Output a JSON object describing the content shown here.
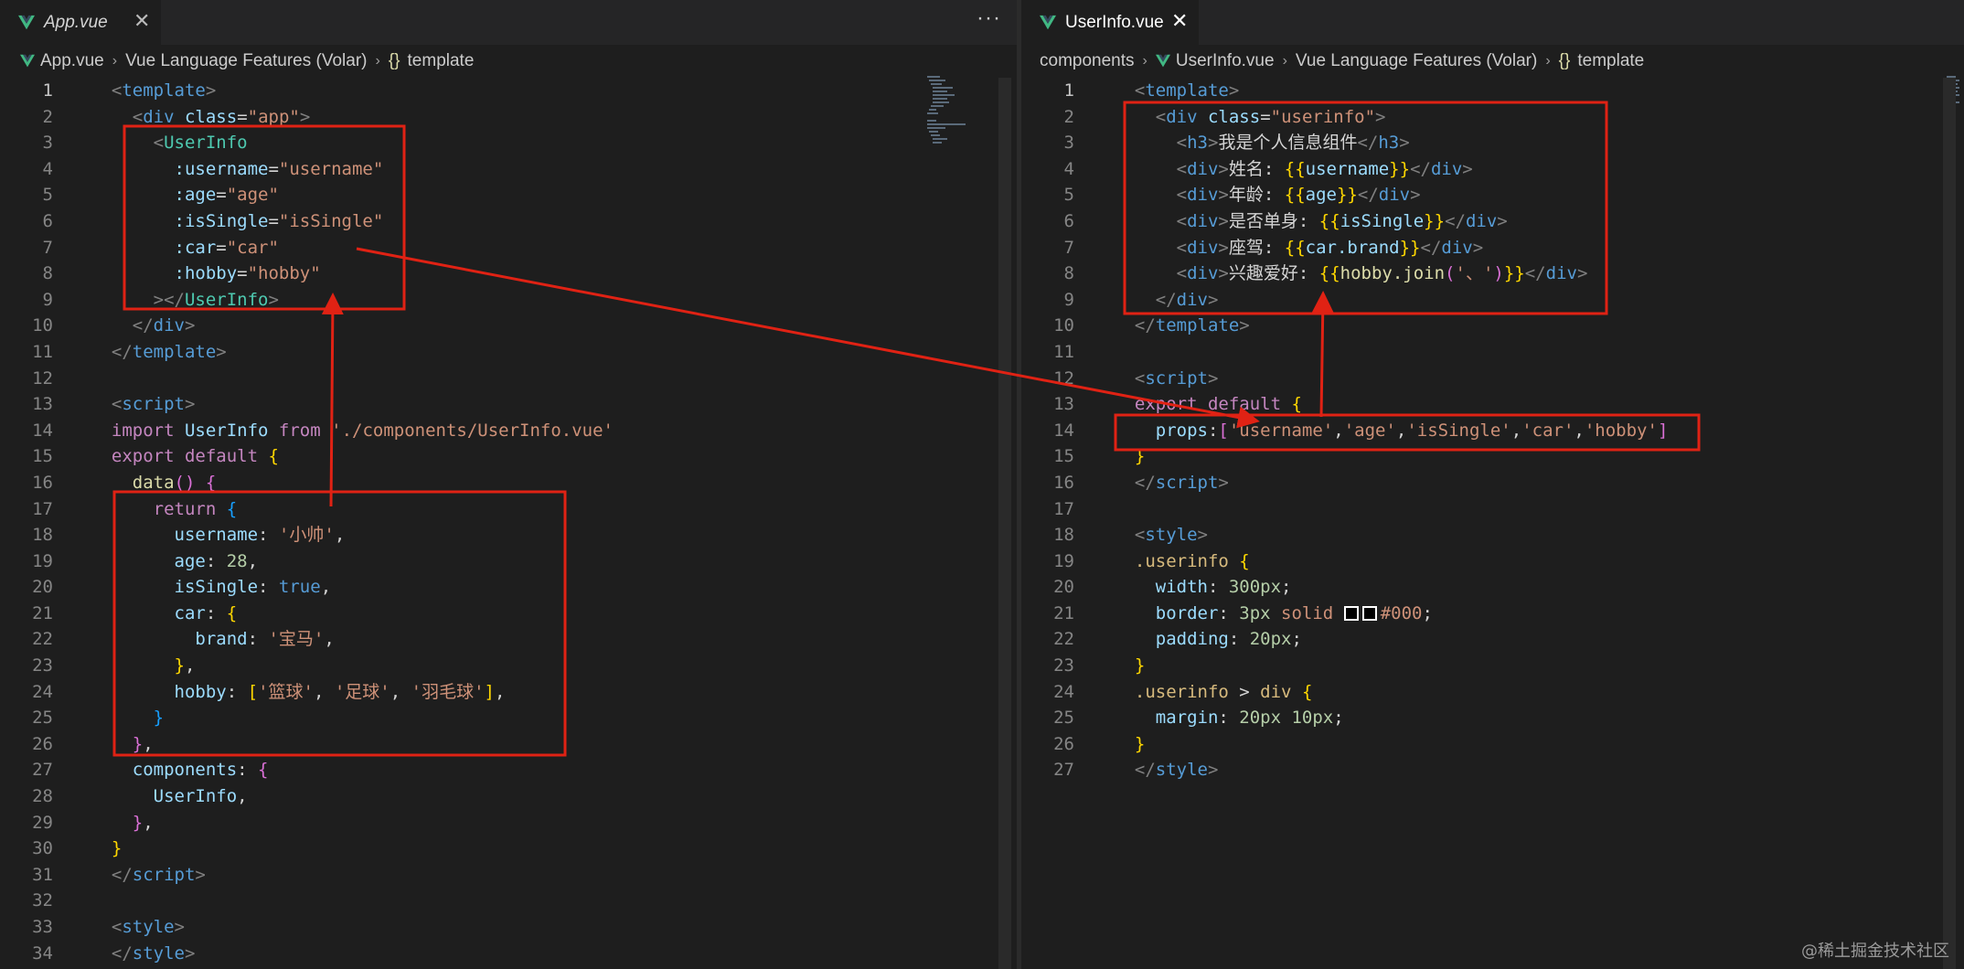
{
  "left": {
    "tab": {
      "title": "App.vue",
      "close": "✕"
    },
    "more": "···",
    "breadcrumb": [
      "App.vue",
      "Vue Language Features (Volar)",
      "template"
    ],
    "active_line": 1,
    "lines": [
      [
        [
          "  ",
          "t"
        ],
        [
          "<",
          "g"
        ],
        [
          "template",
          "b"
        ],
        [
          ">",
          "g"
        ]
      ],
      [
        [
          "    ",
          "t"
        ],
        [
          "<",
          "g"
        ],
        [
          "div",
          "b"
        ],
        [
          " class",
          "l"
        ],
        [
          "=",
          "t"
        ],
        [
          "\"app\"",
          "o"
        ],
        [
          ">",
          "g"
        ]
      ],
      [
        [
          "      ",
          "t"
        ],
        [
          "<",
          "g"
        ],
        [
          "UserInfo",
          "c"
        ]
      ],
      [
        [
          "        :username",
          "l"
        ],
        [
          "=",
          "t"
        ],
        [
          "\"username\"",
          "o"
        ]
      ],
      [
        [
          "        :age",
          "l"
        ],
        [
          "=",
          "t"
        ],
        [
          "\"age\"",
          "o"
        ]
      ],
      [
        [
          "        :isSingle",
          "l"
        ],
        [
          "=",
          "t"
        ],
        [
          "\"isSingle\"",
          "o"
        ]
      ],
      [
        [
          "        :car",
          "l"
        ],
        [
          "=",
          "t"
        ],
        [
          "\"car\"",
          "o"
        ]
      ],
      [
        [
          "        :hobby",
          "l"
        ],
        [
          "=",
          "t"
        ],
        [
          "\"hobby\"",
          "o"
        ]
      ],
      [
        [
          "      ",
          "t"
        ],
        [
          "></",
          "g"
        ],
        [
          "UserInfo",
          "c"
        ],
        [
          ">",
          "g"
        ]
      ],
      [
        [
          "    ",
          "t"
        ],
        [
          "</",
          "g"
        ],
        [
          "div",
          "b"
        ],
        [
          ">",
          "g"
        ]
      ],
      [
        [
          "  ",
          "t"
        ],
        [
          "</",
          "g"
        ],
        [
          "template",
          "b"
        ],
        [
          ">",
          "g"
        ]
      ],
      [],
      [
        [
          "  ",
          "t"
        ],
        [
          "<",
          "g"
        ],
        [
          "script",
          "b"
        ],
        [
          ">",
          "g"
        ]
      ],
      [
        [
          "  import",
          "p"
        ],
        [
          " UserInfo ",
          "l"
        ],
        [
          "from",
          "p"
        ],
        [
          " '",
          "o"
        ],
        [
          "./components/UserInfo.vue",
          "o"
        ],
        [
          "'",
          "o"
        ]
      ],
      [
        [
          "  export",
          "p"
        ],
        [
          " default",
          "p"
        ],
        [
          " {",
          "y"
        ]
      ],
      [
        [
          "    data",
          "f"
        ],
        [
          "()",
          "p2"
        ],
        [
          " {",
          "p2"
        ]
      ],
      [
        [
          "      return",
          "p"
        ],
        [
          " {",
          "b2"
        ]
      ],
      [
        [
          "        username",
          "l"
        ],
        [
          ": ",
          "t"
        ],
        [
          "'小帅'",
          "o"
        ],
        [
          ",",
          "t"
        ]
      ],
      [
        [
          "        age",
          "l"
        ],
        [
          ": ",
          "t"
        ],
        [
          "28",
          "n"
        ],
        [
          ",",
          "t"
        ]
      ],
      [
        [
          "        isSingle",
          "l"
        ],
        [
          ": ",
          "t"
        ],
        [
          "true",
          "b"
        ],
        [
          ",",
          "t"
        ]
      ],
      [
        [
          "        car",
          "l"
        ],
        [
          ": ",
          "t"
        ],
        [
          "{",
          "y"
        ]
      ],
      [
        [
          "          brand",
          "l"
        ],
        [
          ": ",
          "t"
        ],
        [
          "'宝马'",
          "o"
        ],
        [
          ",",
          "t"
        ]
      ],
      [
        [
          "        ",
          "t"
        ],
        [
          "}",
          "y"
        ],
        [
          ",",
          "t"
        ]
      ],
      [
        [
          "        hobby",
          "l"
        ],
        [
          ": ",
          "t"
        ],
        [
          "[",
          "y"
        ],
        [
          "'篮球'",
          "o"
        ],
        [
          ", ",
          "t"
        ],
        [
          "'足球'",
          "o"
        ],
        [
          ", ",
          "t"
        ],
        [
          "'羽毛球'",
          "o"
        ],
        [
          "]",
          "y"
        ],
        [
          ",",
          "t"
        ]
      ],
      [
        [
          "      ",
          "t"
        ],
        [
          "}",
          "b2"
        ]
      ],
      [
        [
          "    ",
          "t"
        ],
        [
          "}",
          "p2"
        ],
        [
          ",",
          "t"
        ]
      ],
      [
        [
          "    components",
          "l"
        ],
        [
          ": ",
          "t"
        ],
        [
          "{",
          "p2"
        ]
      ],
      [
        [
          "      UserInfo",
          "l"
        ],
        [
          ",",
          "t"
        ]
      ],
      [
        [
          "    ",
          "t"
        ],
        [
          "}",
          "p2"
        ],
        [
          ",",
          "t"
        ]
      ],
      [
        [
          "  ",
          "t"
        ],
        [
          "}",
          "y"
        ]
      ],
      [
        [
          "  ",
          "t"
        ],
        [
          "</",
          "g"
        ],
        [
          "script",
          "b"
        ],
        [
          ">",
          "g"
        ]
      ],
      [],
      [
        [
          "  ",
          "t"
        ],
        [
          "<",
          "g"
        ],
        [
          "style",
          "b"
        ],
        [
          ">",
          "g"
        ]
      ],
      [
        [
          "  ",
          "t"
        ],
        [
          "</",
          "g"
        ],
        [
          "style",
          "b"
        ],
        [
          ">",
          "g"
        ]
      ]
    ]
  },
  "right": {
    "tab": {
      "title": "UserInfo.vue",
      "close": "✕"
    },
    "breadcrumb": [
      "components",
      "UserInfo.vue",
      "Vue Language Features (Volar)",
      "template"
    ],
    "active_line": 1,
    "lines": [
      [
        [
          "  ",
          "t"
        ],
        [
          "<",
          "g"
        ],
        [
          "template",
          "b"
        ],
        [
          ">",
          "g"
        ]
      ],
      [
        [
          "    ",
          "t"
        ],
        [
          "<",
          "g"
        ],
        [
          "div",
          "b"
        ],
        [
          " class",
          "l"
        ],
        [
          "=",
          "t"
        ],
        [
          "\"userinfo\"",
          "o"
        ],
        [
          ">",
          "g"
        ]
      ],
      [
        [
          "      ",
          "t"
        ],
        [
          "<",
          "g"
        ],
        [
          "h3",
          "b"
        ],
        [
          ">",
          "g"
        ],
        [
          "我是个人信息组件",
          "t"
        ],
        [
          "</",
          "g"
        ],
        [
          "h3",
          "b"
        ],
        [
          ">",
          "g"
        ]
      ],
      [
        [
          "      ",
          "t"
        ],
        [
          "<",
          "g"
        ],
        [
          "div",
          "b"
        ],
        [
          ">",
          "g"
        ],
        [
          "姓名: ",
          "t"
        ],
        [
          "{{",
          "y"
        ],
        [
          "username",
          "l"
        ],
        [
          "}}",
          "y"
        ],
        [
          "</",
          "g"
        ],
        [
          "div",
          "b"
        ],
        [
          ">",
          "g"
        ]
      ],
      [
        [
          "      ",
          "t"
        ],
        [
          "<",
          "g"
        ],
        [
          "div",
          "b"
        ],
        [
          ">",
          "g"
        ],
        [
          "年龄: ",
          "t"
        ],
        [
          "{{",
          "y"
        ],
        [
          "age",
          "l"
        ],
        [
          "}}",
          "y"
        ],
        [
          "</",
          "g"
        ],
        [
          "div",
          "b"
        ],
        [
          ">",
          "g"
        ]
      ],
      [
        [
          "      ",
          "t"
        ],
        [
          "<",
          "g"
        ],
        [
          "div",
          "b"
        ],
        [
          ">",
          "g"
        ],
        [
          "是否单身: ",
          "t"
        ],
        [
          "{{",
          "y"
        ],
        [
          "isSingle",
          "l"
        ],
        [
          "}}",
          "y"
        ],
        [
          "</",
          "g"
        ],
        [
          "div",
          "b"
        ],
        [
          ">",
          "g"
        ]
      ],
      [
        [
          "      ",
          "t"
        ],
        [
          "<",
          "g"
        ],
        [
          "div",
          "b"
        ],
        [
          ">",
          "g"
        ],
        [
          "座驾: ",
          "t"
        ],
        [
          "{{",
          "y"
        ],
        [
          "car.brand",
          "l"
        ],
        [
          "}}",
          "y"
        ],
        [
          "</",
          "g"
        ],
        [
          "div",
          "b"
        ],
        [
          ">",
          "g"
        ]
      ],
      [
        [
          "      ",
          "t"
        ],
        [
          "<",
          "g"
        ],
        [
          "div",
          "b"
        ],
        [
          ">",
          "g"
        ],
        [
          "兴趣爱好: ",
          "t"
        ],
        [
          "{{",
          "y"
        ],
        [
          "hobby.join",
          "f"
        ],
        [
          "(",
          "p2"
        ],
        [
          "'、'",
          "o"
        ],
        [
          ")",
          "p2"
        ],
        [
          "}}",
          "y"
        ],
        [
          "</",
          "g"
        ],
        [
          "div",
          "b"
        ],
        [
          ">",
          "g"
        ]
      ],
      [
        [
          "    ",
          "t"
        ],
        [
          "</",
          "g"
        ],
        [
          "div",
          "b"
        ],
        [
          ">",
          "g"
        ]
      ],
      [
        [
          "  ",
          "t"
        ],
        [
          "</",
          "g"
        ],
        [
          "template",
          "b"
        ],
        [
          ">",
          "g"
        ]
      ],
      [],
      [
        [
          "  ",
          "t"
        ],
        [
          "<",
          "g"
        ],
        [
          "script",
          "b"
        ],
        [
          ">",
          "g"
        ]
      ],
      [
        [
          "  export",
          "p"
        ],
        [
          " default",
          "p"
        ],
        [
          " {",
          "y"
        ]
      ],
      [
        [
          "    props",
          "l"
        ],
        [
          ":",
          "t"
        ],
        [
          "[",
          "p2"
        ],
        [
          "'username'",
          "o"
        ],
        [
          ",",
          "t"
        ],
        [
          "'age'",
          "o"
        ],
        [
          ",",
          "t"
        ],
        [
          "'isSingle'",
          "o"
        ],
        [
          ",",
          "t"
        ],
        [
          "'car'",
          "o"
        ],
        [
          ",",
          "t"
        ],
        [
          "'hobby'",
          "o"
        ],
        [
          "]",
          "p2"
        ]
      ],
      [
        [
          "  ",
          "t"
        ],
        [
          "}",
          "y"
        ]
      ],
      [
        [
          "  ",
          "t"
        ],
        [
          "</",
          "g"
        ],
        [
          "script",
          "b"
        ],
        [
          ">",
          "g"
        ]
      ],
      [],
      [
        [
          "  ",
          "t"
        ],
        [
          "<",
          "g"
        ],
        [
          "style",
          "b"
        ],
        [
          ">",
          "g"
        ]
      ],
      [
        [
          "  .userinfo",
          "y2"
        ],
        [
          " {",
          "y"
        ]
      ],
      [
        [
          "    width",
          "l"
        ],
        [
          ": ",
          "t"
        ],
        [
          "300px",
          "n"
        ],
        [
          ";",
          "t"
        ]
      ],
      [
        [
          "    border",
          "l"
        ],
        [
          ": ",
          "t"
        ],
        [
          "3px",
          "n"
        ],
        [
          " solid ",
          "o"
        ],
        [
          "SWATCH",
          "sw"
        ],
        [
          "#000",
          "o"
        ],
        [
          ";",
          "t"
        ]
      ],
      [
        [
          "    padding",
          "l"
        ],
        [
          ": ",
          "t"
        ],
        [
          "20px",
          "n"
        ],
        [
          ";",
          "t"
        ]
      ],
      [
        [
          "  ",
          "t"
        ],
        [
          "}",
          "y"
        ]
      ],
      [
        [
          "  .userinfo",
          "y2"
        ],
        [
          " > ",
          "t"
        ],
        [
          "div",
          "y2"
        ],
        [
          " {",
          "y"
        ]
      ],
      [
        [
          "    margin",
          "l"
        ],
        [
          ": ",
          "t"
        ],
        [
          "20px 10px",
          "n"
        ],
        [
          ";",
          "t"
        ]
      ],
      [
        [
          "  ",
          "t"
        ],
        [
          "}",
          "y"
        ]
      ],
      [
        [
          "  ",
          "t"
        ],
        [
          "</",
          "g"
        ],
        [
          "style",
          "b"
        ],
        [
          ">",
          "g"
        ]
      ]
    ]
  },
  "watermark": "@稀土掘金技术社区",
  "colors": {
    "t": "#d4d4d4",
    "g": "#808080",
    "b": "#569cd6",
    "c": "#4ec9b0",
    "l": "#9cdcfe",
    "o": "#ce9178",
    "p": "#c586c0",
    "y": "#ffd700",
    "f": "#dcdcaa",
    "n": "#b5cea8",
    "p2": "#da70d6",
    "b2": "#179fff",
    "y2": "#d7ba7d",
    "vue": "#41b883",
    "annotation": "#e02214"
  }
}
